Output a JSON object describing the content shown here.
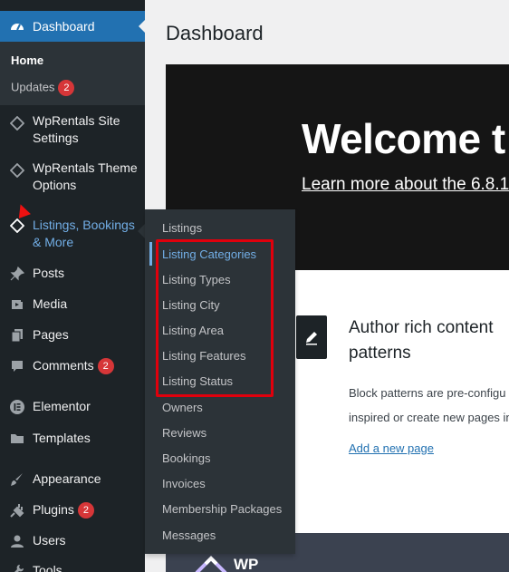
{
  "sidebar": {
    "dashboard": "Dashboard",
    "submenu": {
      "home": "Home",
      "updates": "Updates",
      "updates_count": "2"
    },
    "items": [
      {
        "label": "WpRentals Site Settings",
        "icon": "diamond-icon"
      },
      {
        "label": "WpRentals Theme Options",
        "icon": "diamond-icon"
      },
      {
        "label": "Listings, Bookings & More",
        "icon": "diamond-icon"
      },
      {
        "label": "Posts",
        "icon": "pin-icon"
      },
      {
        "label": "Media",
        "icon": "media-icon"
      },
      {
        "label": "Pages",
        "icon": "pages-icon"
      },
      {
        "label": "Comments",
        "icon": "comment-icon",
        "badge": "2"
      },
      {
        "label": "Elementor",
        "icon": "elementor-icon"
      },
      {
        "label": "Templates",
        "icon": "folder-icon"
      },
      {
        "label": "Appearance",
        "icon": "brush-icon"
      },
      {
        "label": "Plugins",
        "icon": "plug-icon",
        "badge": "2"
      },
      {
        "label": "Users",
        "icon": "user-icon"
      },
      {
        "label": "Tools",
        "icon": "wrench-icon"
      }
    ]
  },
  "flyout": {
    "items": [
      "Listings",
      "Listing Categories",
      "Listing Types",
      "Listing City",
      "Listing Area",
      "Listing Features",
      "Listing Status",
      "Owners",
      "Reviews",
      "Bookings",
      "Invoices",
      "Membership Packages",
      "Messages"
    ],
    "current": "Listing Categories"
  },
  "main": {
    "title": "Dashboard",
    "welcome": {
      "heading": "Welcome t",
      "link": "Learn more about the 6.8.1"
    },
    "card": {
      "heading_line1": "Author rich content",
      "heading_line2": "patterns",
      "text_line1": "Block patterns are pre-configu",
      "text_line2": "inspired or create new pages in",
      "link": "Add a new page"
    },
    "bottom_logo_text": "WP"
  },
  "colors": {
    "sidebar_bg": "#1d2327",
    "accent": "#2271b1",
    "active_link": "#72aee6",
    "badge": "#d63638",
    "highlight": "#e0000c"
  }
}
